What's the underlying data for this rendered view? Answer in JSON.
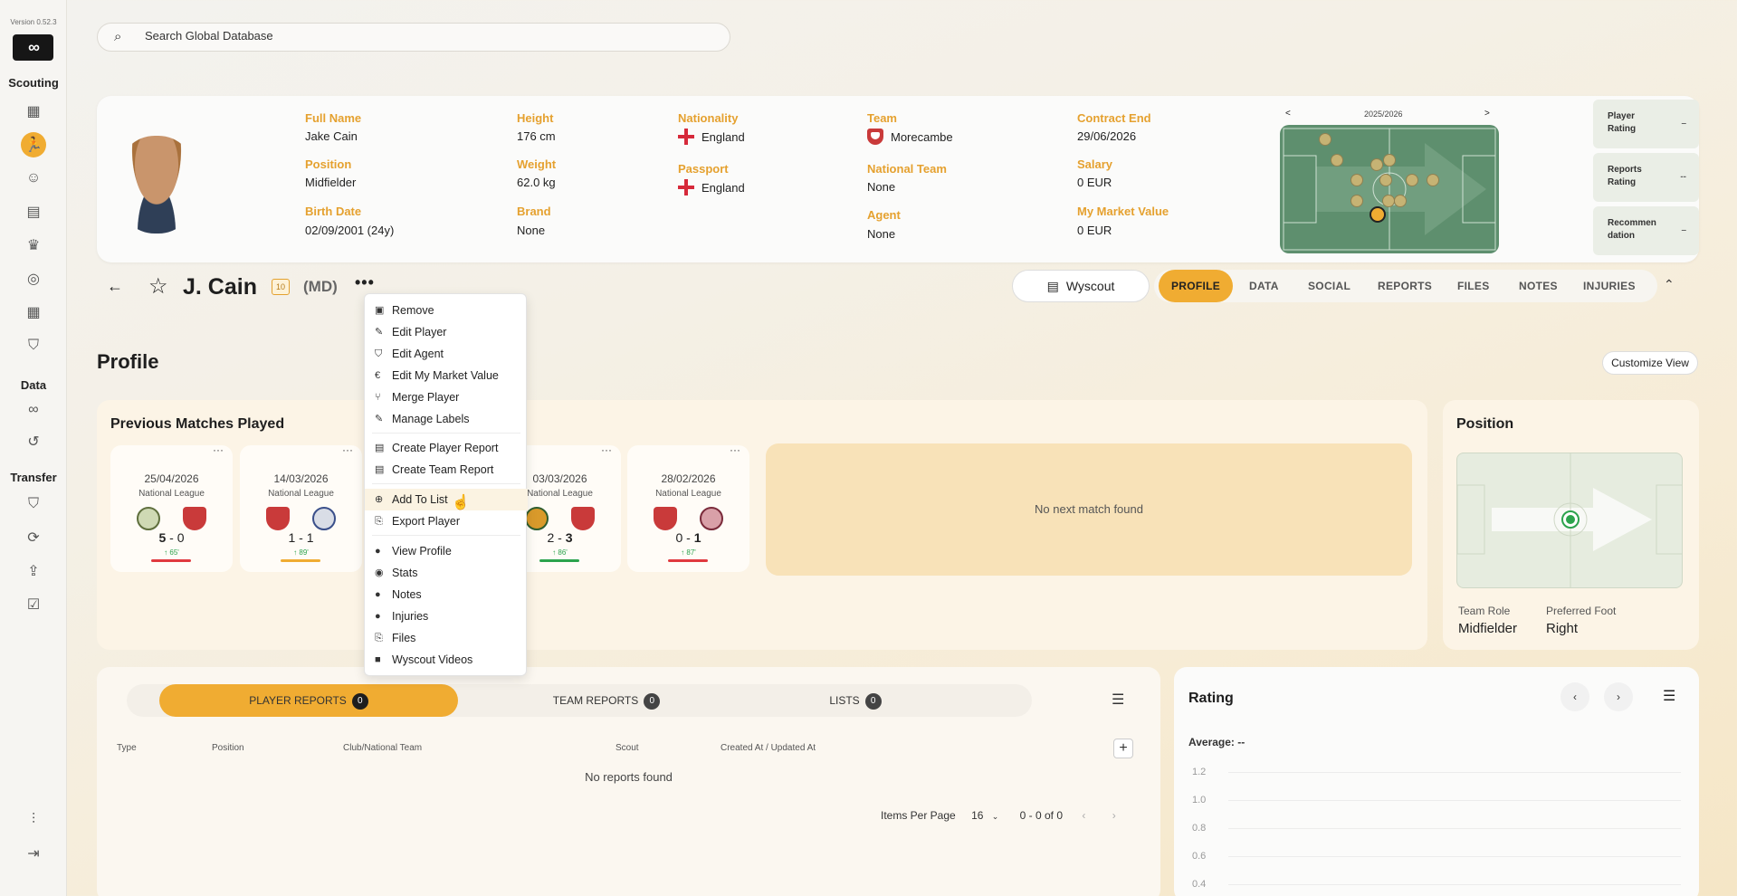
{
  "sidebar": {
    "version": "Version 0.52.3",
    "logo": "∞",
    "sections": {
      "scouting": "Scouting",
      "data": "Data",
      "transfer": "Transfer"
    }
  },
  "search": {
    "placeholder": "Search Global Database"
  },
  "player": {
    "full_name_label": "Full Name",
    "full_name": "Jake Cain",
    "position_label": "Position",
    "position": "Midfielder",
    "birth_label": "Birth Date",
    "birth": "02/09/2001 (24y)",
    "height_label": "Height",
    "height": "176 cm",
    "weight_label": "Weight",
    "weight": "62.0 kg",
    "brand_label": "Brand",
    "brand": "None",
    "nationality_label": "Nationality",
    "nationality": "England",
    "passport_label": "Passport",
    "passport": "England",
    "team_label": "Team",
    "team": "Morecambe",
    "national_team_label": "National Team",
    "national_team": "None",
    "agent_label": "Agent",
    "agent": "None",
    "contract_label": "Contract End",
    "contract": "29/06/2026",
    "salary_label": "Salary",
    "salary": "0 EUR",
    "market_label": "My Market Value",
    "market": "0 EUR",
    "short_name": "J. Cain",
    "shirt": "10",
    "pos_short": "(MD)"
  },
  "season": {
    "label": "2025/2026",
    "prev": "<",
    "next": ">"
  },
  "ratings": [
    {
      "l1": "Player",
      "l2": "Rating",
      "v": "–"
    },
    {
      "l1": "Reports",
      "l2": "Rating",
      "v": "--"
    },
    {
      "l1": "Recommen",
      "l2": "dation",
      "v": "–"
    }
  ],
  "header": {
    "wyscout": "Wyscout",
    "collapse": "⌃"
  },
  "tabs": [
    "PROFILE",
    "DATA",
    "SOCIAL",
    "REPORTS",
    "FILES",
    "NOTES",
    "INJURIES"
  ],
  "profile": {
    "title": "Profile",
    "customize": "Customize View"
  },
  "matches": {
    "title": "Previous Matches Played",
    "items": [
      {
        "date": "25/04/2026",
        "league": "National League",
        "h": "5",
        "a": "0",
        "min": "↑ 65'",
        "bar": "#e0393e"
      },
      {
        "date": "14/03/2026",
        "league": "National League",
        "h": "1",
        "a": "1",
        "min": "↑ 89'",
        "bar": "#f0ac32"
      },
      {
        "date": "03/03/2026",
        "league": "National League",
        "h": "2",
        "a": "3",
        "min": "↑ 86'",
        "bar": "#2ca34d"
      },
      {
        "date": "28/02/2026",
        "league": "National League",
        "h": "0",
        "a": "1",
        "min": "↑ 87'",
        "bar": "#e0393e"
      }
    ],
    "no_next": "No next match found",
    "more": "···"
  },
  "position_card": {
    "title": "Position",
    "role_label": "Team Role",
    "role": "Midfielder",
    "foot_label": "Preferred Foot",
    "foot": "Right"
  },
  "reports": {
    "tabs": [
      {
        "label": "PLAYER REPORTS",
        "count": "0"
      },
      {
        "label": "TEAM REPORTS",
        "count": "0"
      },
      {
        "label": "LISTS",
        "count": "0"
      }
    ],
    "cols": [
      "Type",
      "Position",
      "Club/National Team",
      "Scout",
      "Created At / Updated At"
    ],
    "empty": "No reports found",
    "items_per_page_label": "Items Per Page",
    "items_per_page": "16",
    "range": "0 - 0 of 0"
  },
  "rating": {
    "title": "Rating",
    "average": "Average: --",
    "ticks": [
      "1.2",
      "1.0",
      "0.8",
      "0.6",
      "0.4"
    ]
  },
  "menu": {
    "items": [
      "Remove",
      "Edit Player",
      "Edit Agent",
      "Edit My Market Value",
      "Merge Player",
      "Manage Labels",
      "Create Player Report",
      "Create Team Report",
      "Add To List",
      "Export Player",
      "View Profile",
      "Stats",
      "Notes",
      "Injuries",
      "Files",
      "Wyscout Videos"
    ]
  },
  "colors": {
    "accent": "#f0ac32",
    "label": "#e5a12f",
    "pitch": "#5e8f6e"
  }
}
